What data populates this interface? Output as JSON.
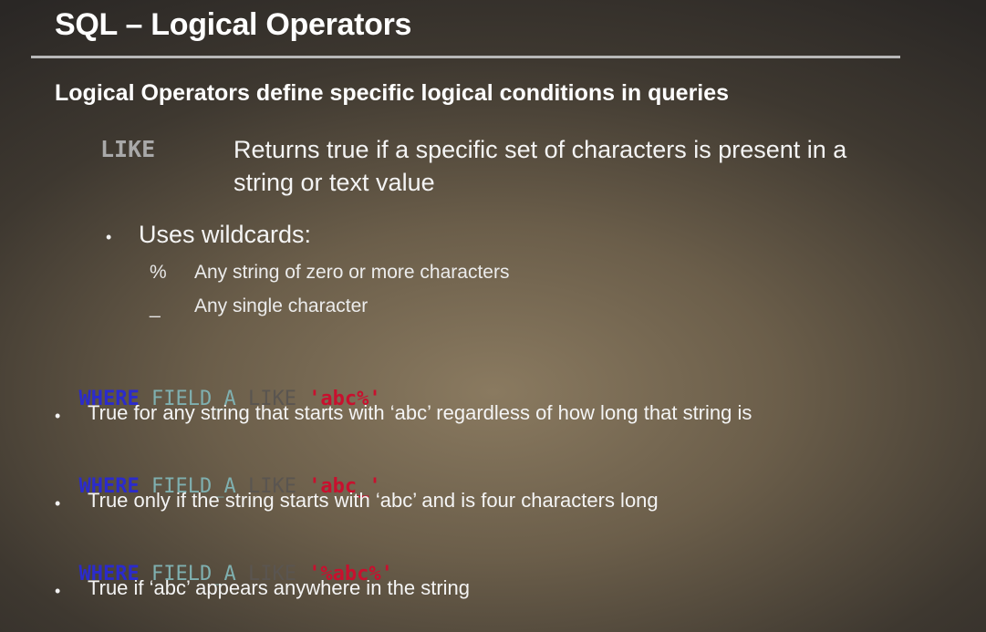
{
  "slide": {
    "title": "SQL – Logical Operators",
    "subtitle": "Logical Operators define specific logical conditions in queries",
    "operator": {
      "keyword": "LIKE",
      "definition": "Returns true if a specific set of characters is present in a string or text value"
    },
    "wildcards": {
      "label": "Uses wildcards:",
      "items": [
        {
          "symbol": "%",
          "description": "Any string of zero or more characters"
        },
        {
          "symbol": "_",
          "description": "Any single character"
        }
      ]
    },
    "examples": [
      {
        "where": "WHERE",
        "field": "FIELD_A",
        "like": "LIKE",
        "pattern": "'abc%'",
        "explanation": "True for any string that starts with ‘abc’ regardless of how long that string is"
      },
      {
        "where": "WHERE",
        "field": "FIELD_A",
        "like": "LIKE",
        "pattern": "'abc_'",
        "explanation": "True only if the string starts with ‘abc’ and is four characters long"
      },
      {
        "where": "WHERE",
        "field": "FIELD_A",
        "like": "LIKE",
        "pattern": "'%abc%'",
        "explanation": "True if ‘abc’ appears anywhere in the string"
      }
    ],
    "bullet_glyph": "•"
  }
}
